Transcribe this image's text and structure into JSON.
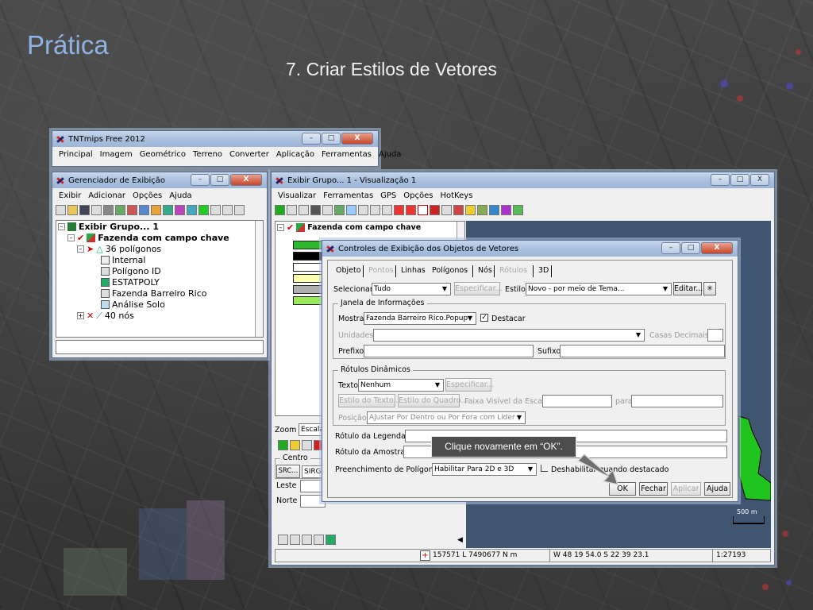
{
  "slide": {
    "title": "Prática",
    "subtitle": "7. Criar Estilos de Vetores",
    "callout": "Clique novamente em “OK”."
  },
  "main_window": {
    "title": "TNTmips Free 2012",
    "menu": [
      "Principal",
      "Imagem",
      "Geométrico",
      "Terreno",
      "Converter",
      "Aplicação",
      "Ferramentas",
      "Ajuda"
    ]
  },
  "display_manager": {
    "title": "Gerenciador de Exibição",
    "menu": [
      "Exibir",
      "Adicionar",
      "Opções",
      "Ajuda"
    ],
    "tree": [
      {
        "label": "Exibir Grupo... 1",
        "bold": true
      },
      {
        "label": "Fazenda com campo chave",
        "bold": true
      },
      {
        "label": "36 polígonos",
        "bold": false
      },
      {
        "label": "Internal",
        "bold": false
      },
      {
        "label": "Polígono ID",
        "bold": false
      },
      {
        "label": "ESTATPOLY",
        "bold": false
      },
      {
        "label": "Fazenda Barreiro Rico",
        "bold": false
      },
      {
        "label": "Análise Solo",
        "bold": false
      },
      {
        "label": "40 nós",
        "bold": false
      }
    ]
  },
  "view_window": {
    "title": "Exibir Grupo... 1 - Visualização 1",
    "menu": [
      "Visualizar",
      "Ferramentas",
      "GPS",
      "Opções",
      "HotKeys"
    ],
    "layer_label": "Fazenda com campo chave",
    "legend_colors": [
      "#2db82d",
      "#000000",
      "#ffffff",
      "#ffffb0",
      "#b0b0b0",
      "#9be85a"
    ],
    "side_labels": {
      "zoom": "Zoom",
      "escala": "Escala",
      "centro": "Centro",
      "src": "SRC...",
      "sirg": "SIRG",
      "leste": "Leste",
      "norte": "Norte"
    },
    "scale_bar": "500 m",
    "status": {
      "coords": "157571 L  7490677 N m",
      "latlon": "W 48 19 54.0  S 22 39 23.1",
      "scale": "1:27193"
    }
  },
  "dialog": {
    "title": "Controles de Exibição dos Objetos de Vetores",
    "tabs": [
      {
        "label": "Objeto",
        "enabled": true
      },
      {
        "label": "Pontos",
        "enabled": false
      },
      {
        "label": "Linhas",
        "enabled": true
      },
      {
        "label": "Polígonos",
        "enabled": true
      },
      {
        "label": "Nós",
        "enabled": true
      },
      {
        "label": "Rótulos",
        "enabled": false
      },
      {
        "label": "3D",
        "enabled": true
      }
    ],
    "selecionar_label": "Selecionar",
    "selecionar_value": "Tudo",
    "especificar": "Especificar...",
    "estilo_label": "Estilo",
    "estilo_value": "Novo - por meio de Tema...",
    "editar": "Editar...",
    "info_group": "Janela de Informações",
    "mostrar_label": "Mostrar",
    "mostrar_value": "Fazenda Barreiro Rico.Popup",
    "destacar": "Destacar",
    "unidades": "Unidades",
    "casas_decimais": "Casas Decimais",
    "prefixo": "Prefixo:",
    "sufixo": "Sufixo:",
    "dyn_group": "Rótulos Dinâmicos",
    "texto_label": "Texto",
    "texto_value": "Nenhum",
    "estilo_texto": "Estilo do Texto...",
    "estilo_quadro": "Estilo do Quadro...",
    "faixa_visivel": "Faixa Visível da Escala",
    "para": "para",
    "posicao_label": "Posição",
    "posicao_value": "Ajustar Por Dentro ou Por Fora com Líder",
    "rotulo_legenda": "Rótulo da Legenda...",
    "rotulo_amostra": "Rótulo da Amostra...",
    "preenchimento_label": "Preenchimento de Polígonos",
    "preenchimento_value": "Habilitar Para 2D e 3D",
    "deshabilitar": "Deshabilitar quando destacado",
    "buttons": {
      "ok": "OK",
      "fechar": "Fechar",
      "aplicar": "Aplicar",
      "ajuda": "Ajuda"
    }
  }
}
